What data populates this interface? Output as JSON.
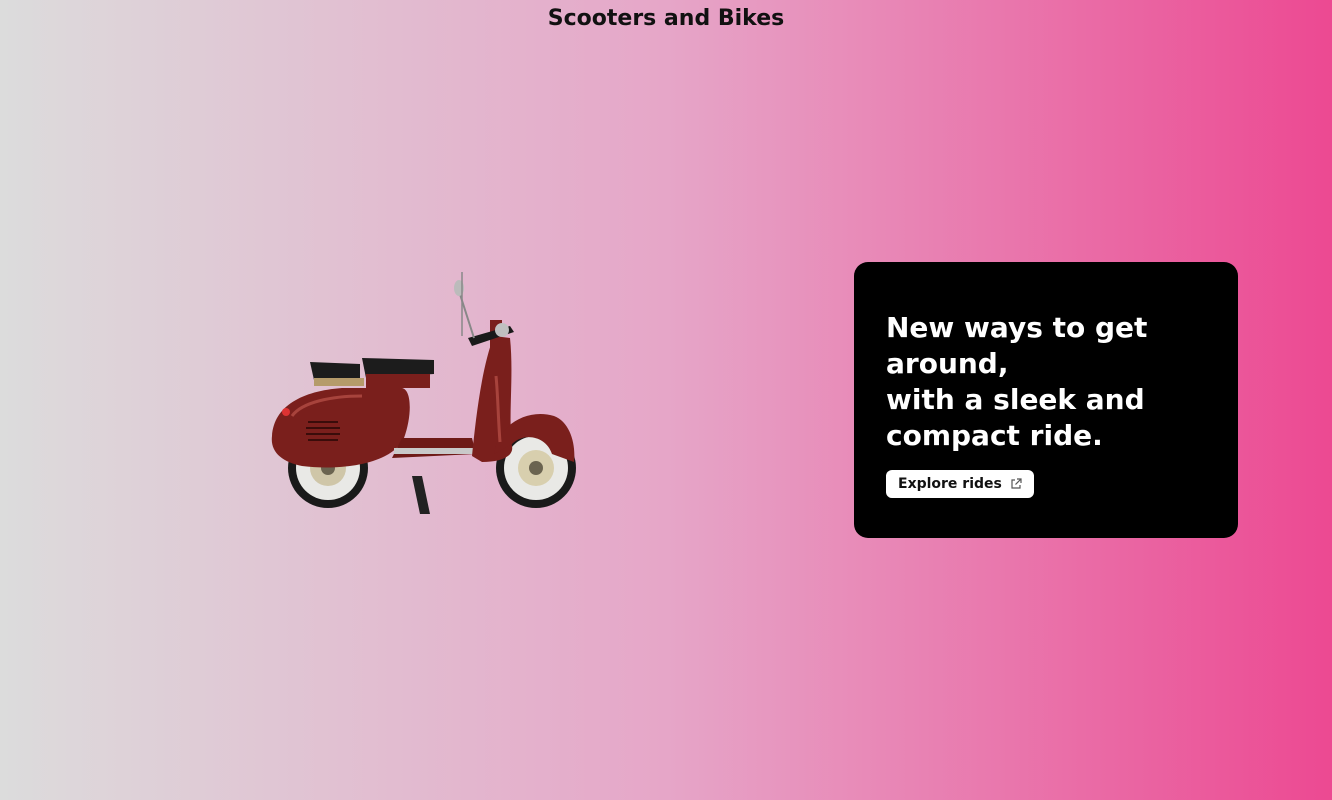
{
  "page": {
    "title": "Scooters and Bikes"
  },
  "hero": {
    "image_alt": "red vintage scooter",
    "headline_line1": "New ways to get around,",
    "headline_line2": "with a sleek and compact ride."
  },
  "cta": {
    "label": "Explore rides",
    "icon": "external-link-icon"
  },
  "colors": {
    "gradient_start": "#dcdcdc",
    "gradient_end": "#ec4992",
    "card_background": "#000000",
    "scooter_body": "#7a1f1c"
  }
}
